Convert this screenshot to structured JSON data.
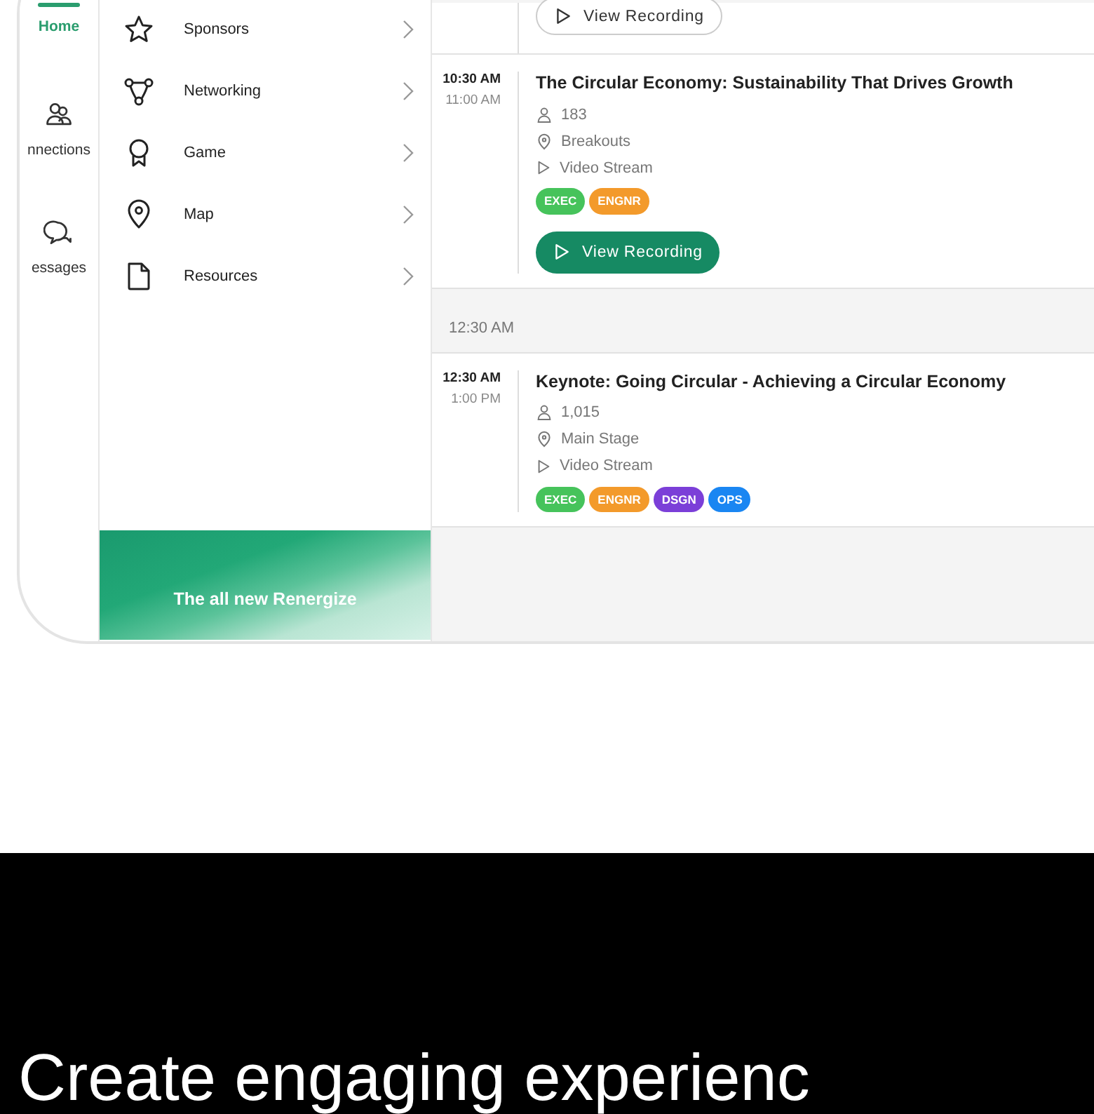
{
  "rail": [
    {
      "label": "Home",
      "selected": true
    },
    {
      "label": "nnections",
      "selected": false
    },
    {
      "label": "essages",
      "selected": false
    }
  ],
  "menu": [
    {
      "label": "Sponsors"
    },
    {
      "label": "Networking"
    },
    {
      "label": "Game"
    },
    {
      "label": "Map"
    },
    {
      "label": "Resources"
    }
  ],
  "banner": {
    "text": "The all new Renergize"
  },
  "schedule": [
    {
      "kind": "partial",
      "recording": {
        "label": "View Recording",
        "kind": "secondary"
      }
    },
    {
      "kind": "session",
      "start": "10:30 AM",
      "end": "11:00 AM",
      "title": "The Circular Economy: Sustainability That Drives Growth",
      "attendees": "183",
      "location": "Breakouts",
      "stream": "Video Stream",
      "tags": [
        {
          "label": "EXEC",
          "color": "#46c35b"
        },
        {
          "label": "ENGNR",
          "color": "#f39a2b"
        }
      ],
      "recording": {
        "label": "View Recording",
        "kind": "primary"
      }
    },
    {
      "kind": "header",
      "label": "12:30 AM"
    },
    {
      "kind": "session",
      "start": "12:30 AM",
      "end": "1:00 PM",
      "title": "Keynote: Going Circular - Achieving a Circular Economy",
      "attendees": "1,015",
      "location": "Main Stage",
      "stream": "Video Stream",
      "tags": [
        {
          "label": "EXEC",
          "color": "#46c35b"
        },
        {
          "label": "ENGNR",
          "color": "#f39a2b"
        },
        {
          "label": "DSGN",
          "color": "#7b3fd8"
        },
        {
          "label": "OPS",
          "color": "#1a86f2"
        }
      ]
    }
  ],
  "footer": {
    "headline": "Create engaging experienc"
  }
}
